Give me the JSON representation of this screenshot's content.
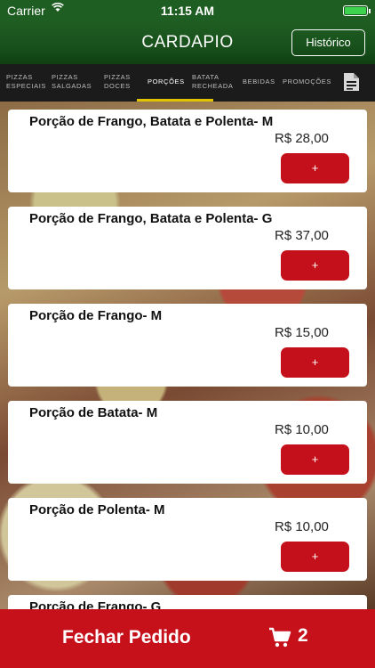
{
  "status_bar": {
    "carrier": "Carrier",
    "time": "11:15 AM",
    "battery_level_percent": 100
  },
  "header": {
    "title": "CARDAPIO",
    "history_button": "Histórico"
  },
  "tabs": [
    {
      "line1": "PIZZAS",
      "line2": "ESPECIAIS",
      "active": false
    },
    {
      "line1": "PIZZAS",
      "line2": "SALGADAS",
      "active": false
    },
    {
      "line1": "PIZZAS",
      "line2": "DOCES",
      "active": false
    },
    {
      "line1": "PORÇÕES",
      "line2": "",
      "active": true
    },
    {
      "line1": "BATATA",
      "line2": "RECHEADA",
      "active": false
    },
    {
      "line1": "BEBIDAS",
      "line2": "",
      "active": false
    },
    {
      "line1": "PROMOÇÕES",
      "line2": "",
      "active": false
    }
  ],
  "items": [
    {
      "name": "Porção de Frango, Batata e Polenta- M",
      "price": "R$ 28,00",
      "button": "+"
    },
    {
      "name": "Porção de Frango, Batata e Polenta- G",
      "price": "R$ 37,00",
      "button": "+"
    },
    {
      "name": "Porção de Frango- M",
      "price": "R$ 15,00",
      "button": "+"
    },
    {
      "name": "Porção de Batata- M",
      "price": "R$ 10,00",
      "button": "+"
    },
    {
      "name": "Porção de Polenta- M",
      "price": "R$ 10,00",
      "button": "+"
    },
    {
      "name": "Porção de Frango- G",
      "price": "",
      "button": ""
    }
  ],
  "footer": {
    "label": "Fechar Pedido",
    "cart_count": "2"
  },
  "colors": {
    "header_green": "#1f5e22",
    "tabs_bg": "#1b1b1b",
    "accent_red": "#c4101b",
    "tab_indicator": "#e0c400"
  },
  "icons": {
    "document": "document-icon",
    "cart": "cart-icon",
    "wifi": "wifi-icon"
  }
}
